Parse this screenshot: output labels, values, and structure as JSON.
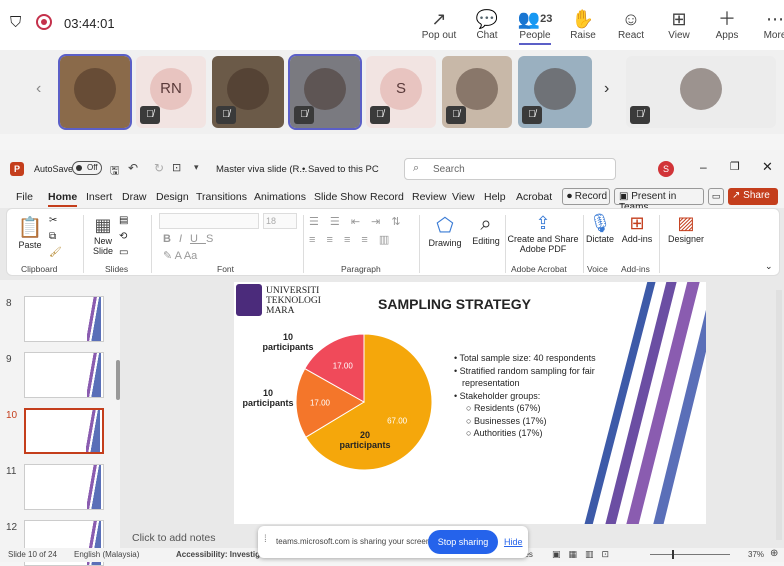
{
  "teams": {
    "timer": "03:44:01",
    "people_count": "23",
    "tools": [
      {
        "icon": "↗",
        "label": "Pop out"
      },
      {
        "icon": "💬",
        "label": "Chat"
      },
      {
        "icon": "👥",
        "label": "People"
      },
      {
        "icon": "✋",
        "label": "Raise"
      },
      {
        "icon": "☺",
        "label": "React"
      },
      {
        "icon": "⊞",
        "label": "View"
      },
      {
        "icon": "＋",
        "label": "Apps"
      },
      {
        "icon": "⋯",
        "label": "More"
      }
    ],
    "participants": [
      {
        "initials": ""
      },
      {
        "initials": "RN"
      },
      {
        "initials": ""
      },
      {
        "initials": ""
      },
      {
        "initials": "S"
      },
      {
        "initials": ""
      },
      {
        "initials": ""
      },
      {
        "initials": ""
      }
    ]
  },
  "ppt": {
    "autosave_label": "AutoSave",
    "autosave_state": "Off",
    "doc_title": "Master viva slide (R...",
    "saved_label": "• Saved to this PC",
    "search_placeholder": "Search",
    "user_initial": "S",
    "menus": [
      "File",
      "Home",
      "Insert",
      "Draw",
      "Design",
      "Transitions",
      "Animations",
      "Slide Show",
      "Record",
      "Review",
      "View",
      "Help",
      "Acrobat"
    ],
    "record_label": "Record",
    "present_label": "Present in Teams",
    "share_label": "Share",
    "ribbon": {
      "paste": "Paste",
      "clipboard": "Clipboard",
      "new_slide": "New",
      "new_slide2": "Slide",
      "slides": "Slides",
      "font_size": "18",
      "font": "Font",
      "paragraph": "Paragraph",
      "drawing": "Drawing",
      "editing": "Editing",
      "create_share": "Create and Share",
      "adobe_pdf": "Adobe PDF",
      "adobe_acrobat": "Adobe Acrobat",
      "dictate": "Dictate",
      "voice": "Voice",
      "addins": "Add-ins",
      "addins_group": "Add-ins",
      "designer": "Designer"
    },
    "thumb_numbers": [
      "8",
      "9",
      "10",
      "11",
      "12"
    ],
    "notes_placeholder": "Click to add notes",
    "status": {
      "slide": "Slide 10 of 24",
      "language": "English (Malaysia)",
      "accessibility": "Accessibility: Investig...",
      "notes": "Notes",
      "zoom": "37%"
    }
  },
  "slide": {
    "title": "SAMPLING STRATEGY",
    "logo_l1": "UNIVERSITI",
    "logo_l2": "TEKNOLOGI",
    "logo_l3": "MARA",
    "labels": {
      "a": "10",
      "a2": "participants",
      "b": "10",
      "b2": "participants",
      "c": "20",
      "c2": "participants"
    },
    "bullets": [
      "Total sample size: 40 respondents",
      "Stratified random sampling for fair",
      "representation",
      "Stakeholder groups:"
    ],
    "sub_bullets": [
      "Residents (67%)",
      "Businesses (17%)",
      "Authorities (17%)"
    ]
  },
  "share": {
    "text": "teams.microsoft.com is sharing your screen.",
    "stop": "Stop sharing",
    "hide": "Hide"
  },
  "chart_data": {
    "type": "pie",
    "categories": [
      "Residents",
      "Businesses",
      "Authorities"
    ],
    "values": [
      67.0,
      17.0,
      17.0
    ],
    "colors": [
      "#f5a70b",
      "#f4762a",
      "#f04a5a"
    ]
  }
}
